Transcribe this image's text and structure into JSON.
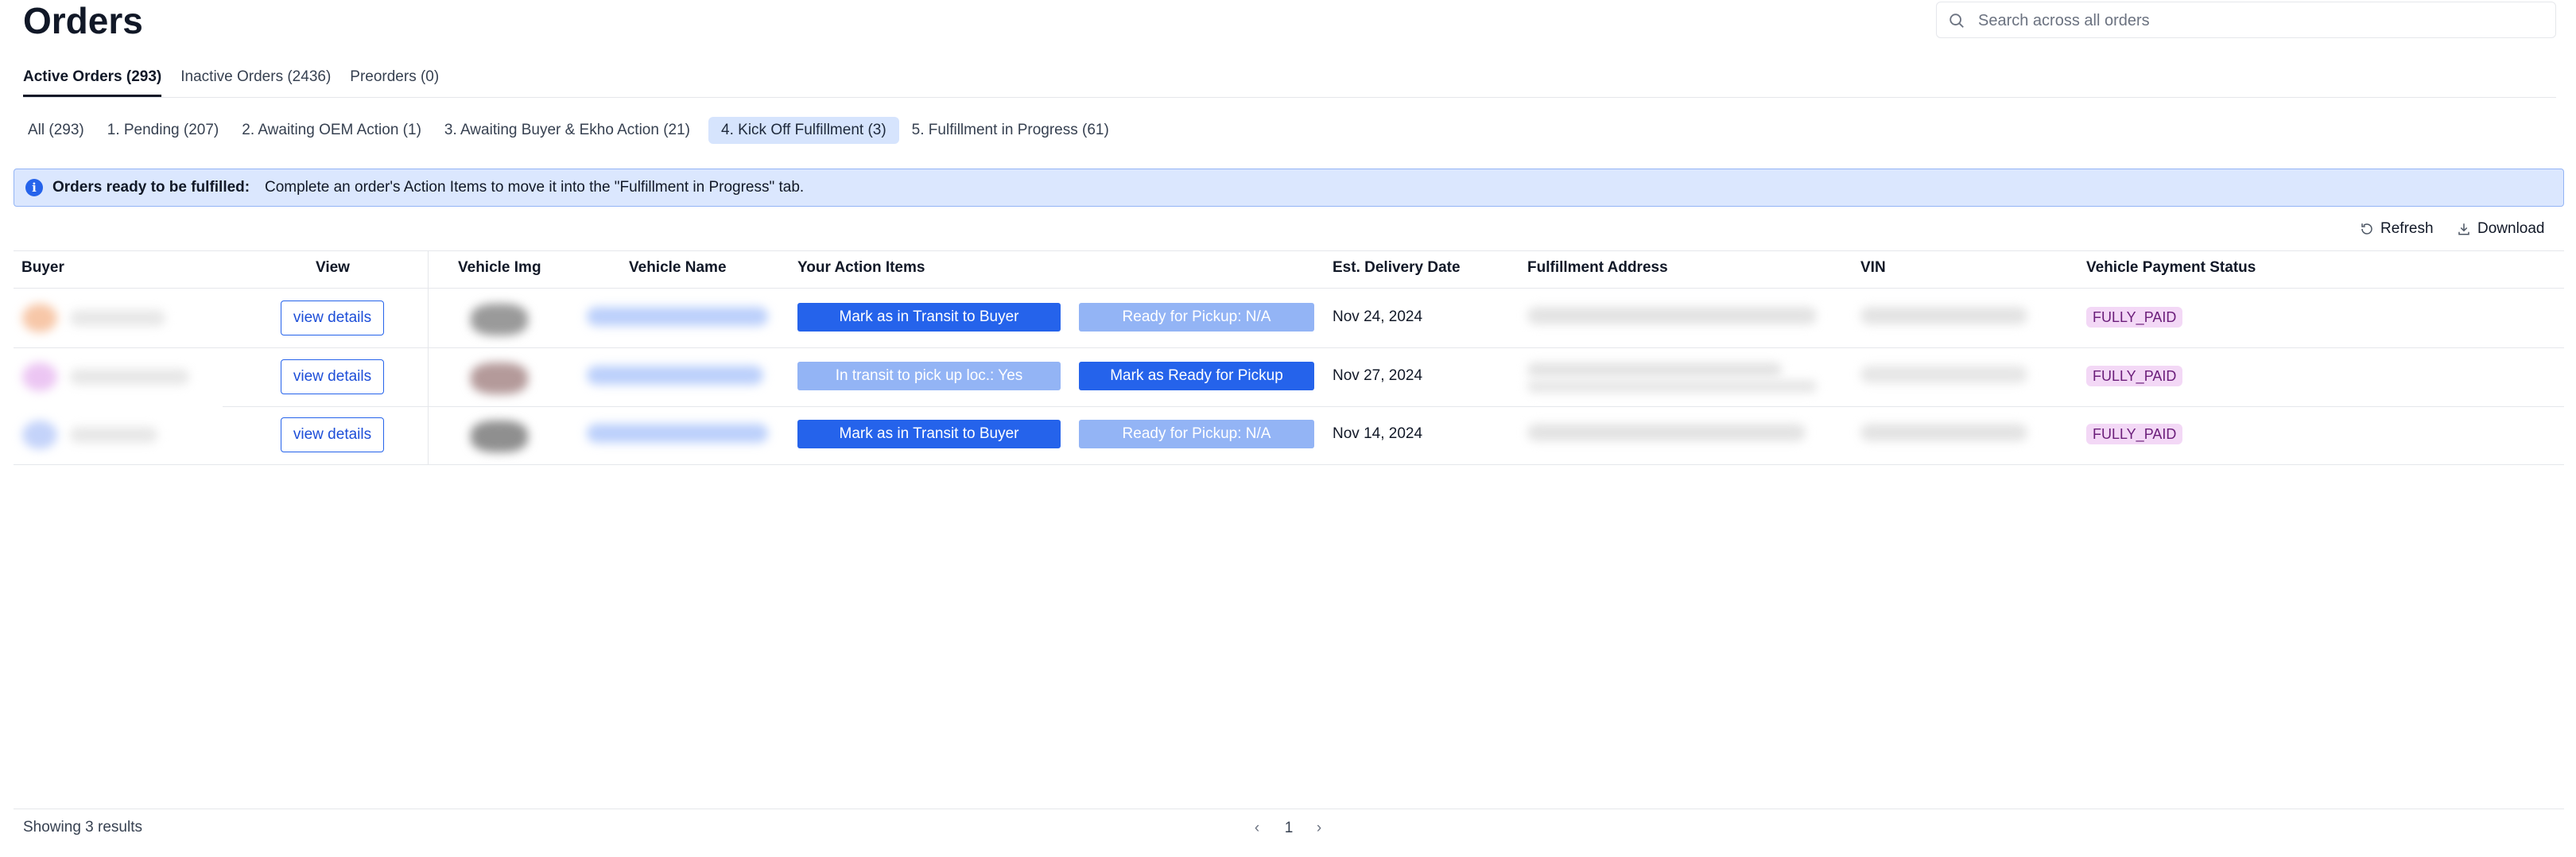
{
  "page": {
    "title": "Orders"
  },
  "search": {
    "placeholder": "Search across all orders"
  },
  "main_tabs": [
    {
      "label": "Active Orders (293)",
      "active": true
    },
    {
      "label": "Inactive Orders (2436)",
      "active": false
    },
    {
      "label": "Preorders (0)",
      "active": false
    }
  ],
  "sub_tabs": [
    {
      "label": "All (293)",
      "active": false
    },
    {
      "label": "1. Pending (207)",
      "active": false
    },
    {
      "label": "2. Awaiting OEM Action (1)",
      "active": false
    },
    {
      "label": "3. Awaiting Buyer & Ekho Action (21)",
      "active": false
    },
    {
      "label": "4. Kick Off Fulfillment (3)",
      "active": true
    },
    {
      "label": "5. Fulfillment in Progress (61)",
      "active": false
    }
  ],
  "banner": {
    "title": "Orders ready to be fulfilled:",
    "message": "Complete an order's Action Items to move it into the \"Fulfillment in Progress\" tab."
  },
  "toolbar": {
    "refresh_label": "Refresh",
    "download_label": "Download"
  },
  "table": {
    "columns": [
      "Buyer",
      "View",
      "Vehicle Img",
      "Vehicle Name",
      "Your Action Items",
      "Est. Delivery Date",
      "Fulfillment Address",
      "VIN",
      "Vehicle Payment Status"
    ],
    "rows": [
      {
        "view_label": "view details",
        "action_1": {
          "label": "Mark as in Transit to Buyer",
          "enabled": true
        },
        "action_2": {
          "label": "Ready for Pickup: N/A",
          "enabled": false
        },
        "delivery_date": "Nov 24, 2024",
        "payment_status": "FULLY_PAID"
      },
      {
        "view_label": "view details",
        "action_1": {
          "label": "In transit to pick up loc.: Yes",
          "enabled": false
        },
        "action_2": {
          "label": "Mark as Ready for Pickup",
          "enabled": true
        },
        "delivery_date": "Nov 27, 2024",
        "payment_status": "FULLY_PAID"
      },
      {
        "view_label": "view details",
        "action_1": {
          "label": "Mark as in Transit to Buyer",
          "enabled": true
        },
        "action_2": {
          "label": "Ready for Pickup: N/A",
          "enabled": false
        },
        "delivery_date": "Nov 14, 2024",
        "payment_status": "FULLY_PAID"
      }
    ]
  },
  "footer": {
    "showing": "Showing 3 results",
    "current_page": "1",
    "prev_icon": "chevron-left-icon",
    "next_icon": "chevron-right-icon"
  },
  "colors": {
    "primary": "#2563eb",
    "primary_disabled": "#93b4f5",
    "active_subtab_bg": "#d6e4fd",
    "banner_bg": "#dbe7fe",
    "badge_bg": "#f3d8f6",
    "badge_text": "#6b1d7a"
  }
}
